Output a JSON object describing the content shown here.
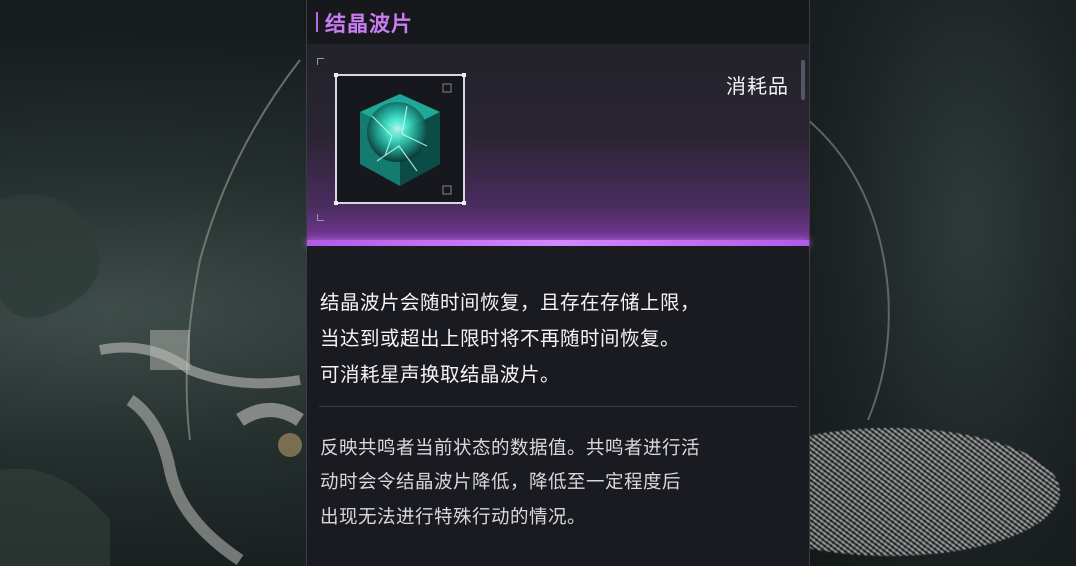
{
  "item": {
    "name": "结晶波片",
    "type": "消耗品",
    "icon": "crystal-cube-icon"
  },
  "description": {
    "lines": [
      "结晶波片会随时间恢复，且存在存储上限，",
      "当达到或超出上限时将不再随时间恢复。",
      "可消耗星声换取结晶波片。"
    ]
  },
  "lore": {
    "lines": [
      "反映共鸣者当前状态的数据值。共鸣者进行活",
      "动时会令结晶波片降低，降低至一定程度后",
      "出现无法进行特殊行动的情况。"
    ]
  },
  "colors": {
    "accent": "#c97df2",
    "glow": "#b35ae6",
    "crystal": "#2fe0c8"
  }
}
